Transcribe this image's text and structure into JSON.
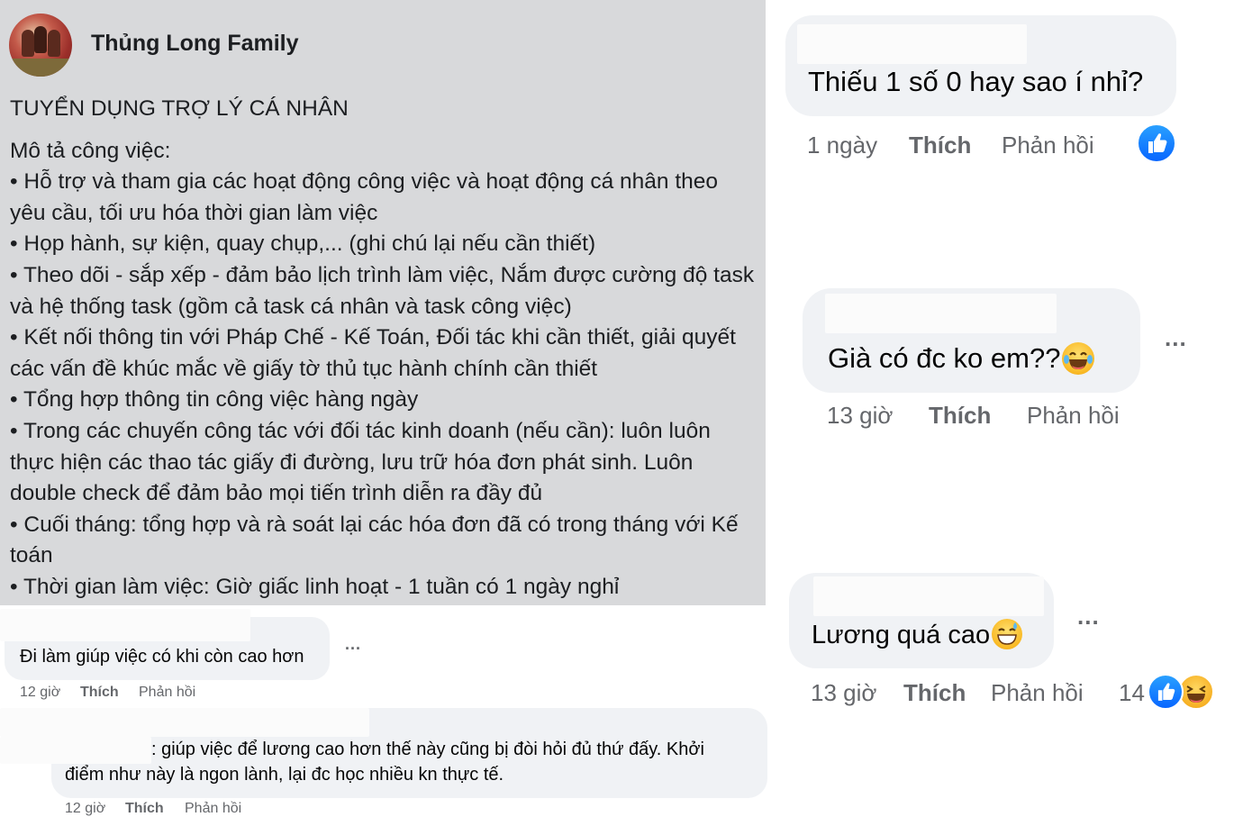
{
  "post": {
    "page_name": "Thủng Long Family",
    "title": "TUYỂN DỤNG TRỢ LÝ CÁ NHÂN",
    "description_heading": "Mô tả công việc:",
    "bullets": [
      "• Hỗ trợ và tham gia các hoạt động công việc và hoạt động cá nhân theo yêu cầu, tối ưu hóa thời gian làm việc",
      "• Họp hành, sự kiện, quay chụp,... (ghi chú lại nếu cần thiết)",
      "• Theo dõi - sắp xếp - đảm bảo lịch trình làm việc, Nắm được cường độ task và hệ thống task (gồm cả task cá nhân và task công việc)",
      "• Kết nối thông tin với Pháp Chế - Kế Toán, Đối tác khi cần thiết, giải quyết các vấn đề khúc mắc về giấy tờ thủ tục hành chính cần thiết",
      "• Tổng hợp thông tin công việc hàng ngày",
      "• Trong các chuyến công tác với đối tác kinh doanh (nếu cần): luôn luôn thực hiện các thao tác giấy đi đường, lưu trữ hóa đơn phát sinh. Luôn double check để đảm bảo mọi tiến trình diễn ra đầy đủ",
      "• Cuối tháng: tổng hợp và rà soát lại các hóa đơn đã có trong tháng với Kế toán",
      "• Thời gian làm việc: Giờ giấc linh hoạt - 1 tuần có 1 ngày nghỉ"
    ]
  },
  "comments": [
    {
      "id": "c1",
      "text": "Đi làm giúp việc có khi còn cao hơn",
      "time": "12 giờ",
      "like_label": "Thích",
      "reply_label": "Phản hồi",
      "more": "..."
    },
    {
      "id": "c2",
      "text": ": giúp việc để lương cao hơn thế này cũng bị đòi hỏi đủ thứ đấy. Khởi",
      "text_line2": "điểm như này là ngon lành, lại đc học nhiều kn thực tế.",
      "time": "12 giờ",
      "like_label": "Thích",
      "reply_label": "Phản hồi"
    },
    {
      "id": "c3",
      "text": "Thiếu 1 số 0 hay sao í nhỉ?",
      "time": "1 ngày",
      "like_label": "Thích",
      "reply_label": "Phản hồi",
      "reactions": [
        "like-icon"
      ]
    },
    {
      "id": "c4",
      "text": "Già có đc ko em??",
      "emoji": "laughing-tears-emoji",
      "time": "13 giờ",
      "like_label": "Thích",
      "reply_label": "Phản hồi",
      "more": "..."
    },
    {
      "id": "c5",
      "text": "Lương quá cao",
      "emoji": "sweat-smile-emoji",
      "time": "13 giờ",
      "like_label": "Thích",
      "reply_label": "Phản hồi",
      "reaction_count": "14",
      "reactions": [
        "like-icon",
        "haha-icon"
      ],
      "more": "..."
    }
  ],
  "colors": {
    "post_background": "#d8d9db",
    "bubble_background": "#f0f2f5",
    "meta_text": "#65676b",
    "like_blue": "#0866ff"
  }
}
